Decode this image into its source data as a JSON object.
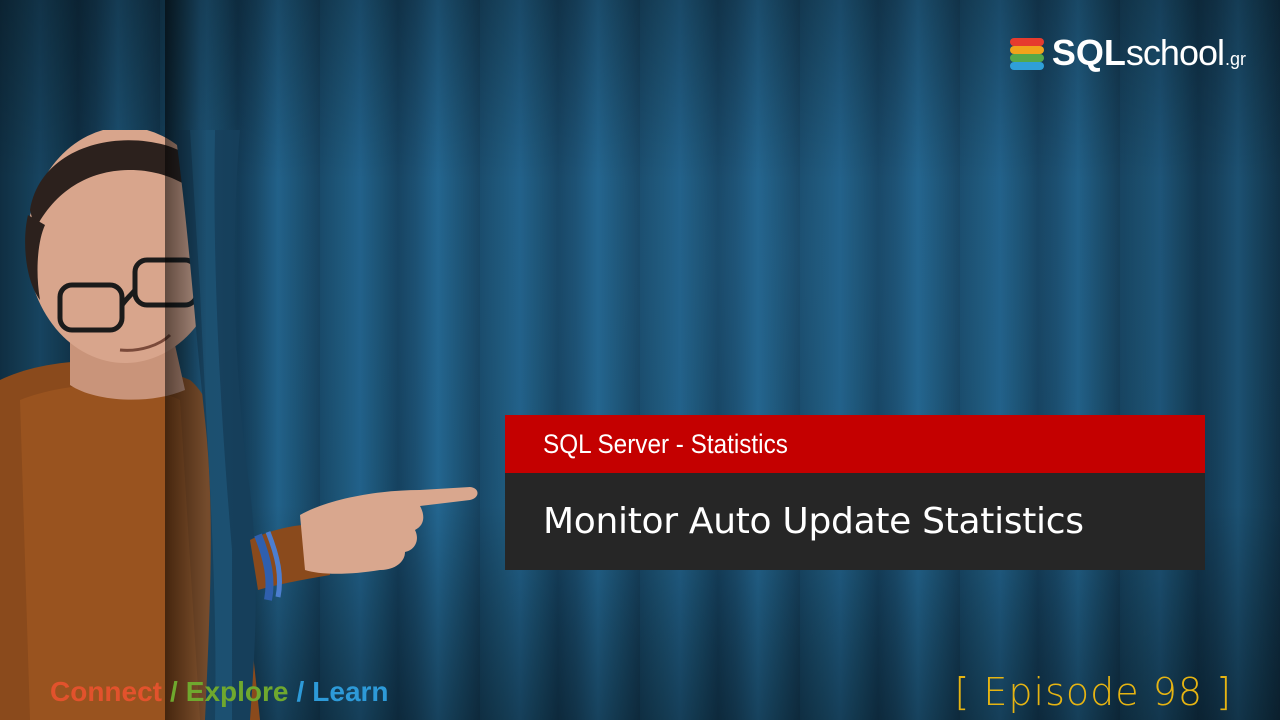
{
  "logo": {
    "sql": "SQL",
    "school": "school",
    "gr": ".gr",
    "colors": [
      "#e63b2e",
      "#f0a31b",
      "#55a84a",
      "#2f9fd8"
    ]
  },
  "banner": {
    "subtitle": "SQL Server - Statistics",
    "title": "Monitor Auto Update Statistics",
    "subtitle_bg": "#c40000",
    "title_bg": "#262626"
  },
  "tagline": {
    "connect": "Connect",
    "explore": "Explore",
    "learn": "Learn",
    "separator": "/",
    "colors": {
      "connect": "#e2522c",
      "explore": "#6fa82e",
      "learn": "#2d9ad8"
    }
  },
  "episode": {
    "label": "[ Episode 98 ]",
    "color": "#e6b412"
  }
}
